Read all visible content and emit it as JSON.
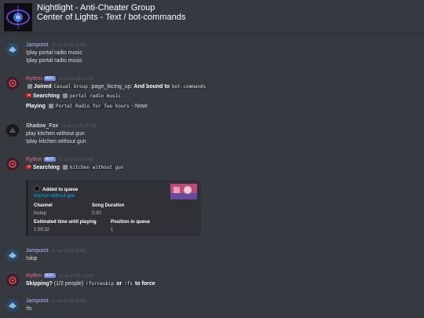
{
  "header": {
    "title": "Nightlight - Anti-Cheater Group",
    "subtitle": "Center of Lights - Text / bot-commands"
  },
  "bot_badge": "BOT",
  "messages": [
    {
      "author": "Jampoint",
      "timestamp": "21-Jul-20 09:13 PM",
      "lines": [
        "!play portal radio music",
        "!play portal radio music"
      ]
    },
    {
      "author": "Rythm",
      "timestamp": "21-Jul-20 09:13 PM",
      "joined": {
        "label": "Joined",
        "channel": "Casual Group",
        "emoji_text": ":page_facing_up:",
        "bound_label": "And bound to",
        "bound_channel": "bot-commands"
      },
      "searching": {
        "label": "Searching",
        "query": "portal radio music"
      },
      "playing": {
        "label": "Playing",
        "track": "Portal Radio for Two hours",
        "suffix": "- Now!"
      }
    },
    {
      "author": "Shadow_Fox",
      "timestamp": "21-Jul-20 09:14 PM",
      "lines": [
        "play kitchen without gun",
        "!play kitchen without gun"
      ]
    },
    {
      "author": "Rythm",
      "timestamp": "21-Jul-20 09:14 PM",
      "searching": {
        "label": "Searching",
        "query": "kitchen without gun"
      },
      "embed": {
        "author": "Added to queue",
        "title": "Kitchen without gun",
        "fields": [
          {
            "name": "Channel",
            "value": "instep"
          },
          {
            "name": "Song Duration",
            "value": "0:30"
          },
          {
            "name": "Estimated time until playing",
            "value": "1:59:32"
          },
          {
            "name": "Position in queue",
            "value": "1"
          }
        ]
      }
    },
    {
      "author": "Jampoint",
      "timestamp": "21-Jul-20 09:14 PM",
      "lines": [
        "!skip"
      ]
    },
    {
      "author": "Rythm",
      "timestamp": "21-Jul-20 09:14 PM",
      "skip": {
        "label": "Skipping?",
        "votes": "(1/2 people)",
        "cmd1": "!forceskip",
        "or": "or",
        "cmd2": "!fs",
        "suffix": "to force"
      }
    },
    {
      "author": "Jampoint",
      "timestamp": "21-Jul-20 09:14 PM",
      "lines": [
        "!fs"
      ]
    }
  ],
  "colors": {
    "background": "#36393f",
    "bot_badge": "#7289da",
    "link": "#00b0f4",
    "rythm": "#f26d8a",
    "jampoint": "#a9b8ff"
  }
}
